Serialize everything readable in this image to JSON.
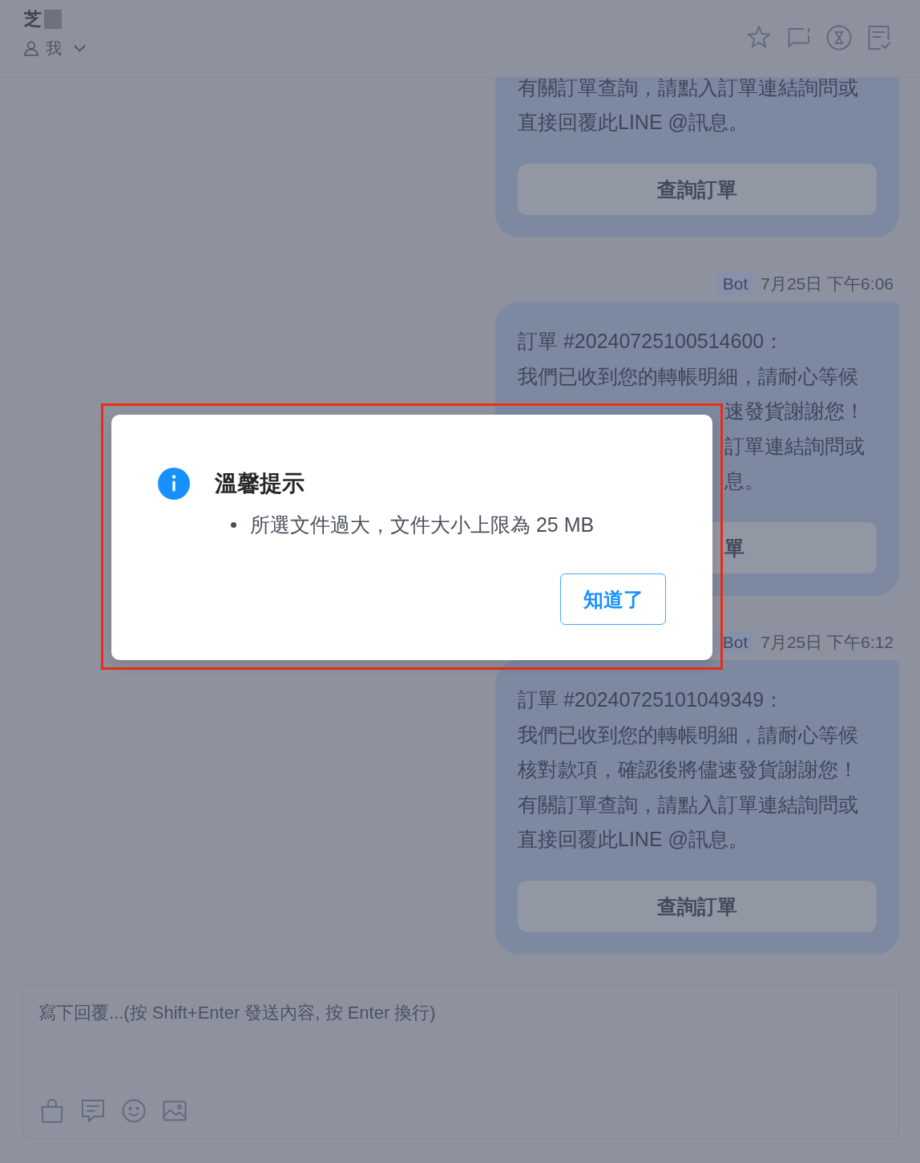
{
  "header": {
    "contact_name": "芝",
    "name_redacted": true,
    "agent": "我"
  },
  "messages": [
    {
      "lines": [
        {
          "text": "有關訂單查詢，請點入訂單連結詢問或",
          "covered": false
        },
        {
          "text": "直接回覆此LINE @訊息。",
          "covered": false
        }
      ],
      "button": {
        "label": "查詢訂單",
        "covered": false
      }
    },
    {
      "sender": "Bot",
      "time": "7月25日 下午6:06",
      "lines": [
        {
          "text": "訂單 #20240725100514600：",
          "covered": false
        },
        {
          "text": "我們已收到您的轉帳明細，請耐心等候",
          "covered": false
        },
        {
          "text": "速發貨謝謝您！",
          "covered": true
        },
        {
          "text": "訂單連結詢問或",
          "covered": true
        },
        {
          "text": "息。",
          "covered": true
        }
      ],
      "button": {
        "label": "單",
        "covered": true
      }
    },
    {
      "sender": "Bot",
      "time": "7月25日 下午6:12",
      "lines": [
        {
          "text": "訂單 #20240725101049349：",
          "covered": false
        },
        {
          "text": "我們已收到您的轉帳明細，請耐心等候",
          "covered": false
        },
        {
          "text": "核對款項，確認後將儘速發貨謝謝您！",
          "covered": false
        },
        {
          "text": "有關訂單查詢，請點入訂單連結詢問或",
          "covered": false
        },
        {
          "text": "直接回覆此LINE @訊息。",
          "covered": false
        }
      ],
      "button": {
        "label": "查詢訂單",
        "covered": false
      }
    }
  ],
  "composer": {
    "placeholder": "寫下回覆...(按 Shift+Enter 發送內容, 按 Enter 換行)"
  },
  "dialog": {
    "kind": "info",
    "title": "溫馨提示",
    "items": [
      "所選文件過大，文件大小上限為 25 MB"
    ],
    "button": "知道了",
    "highlighted": true
  }
}
